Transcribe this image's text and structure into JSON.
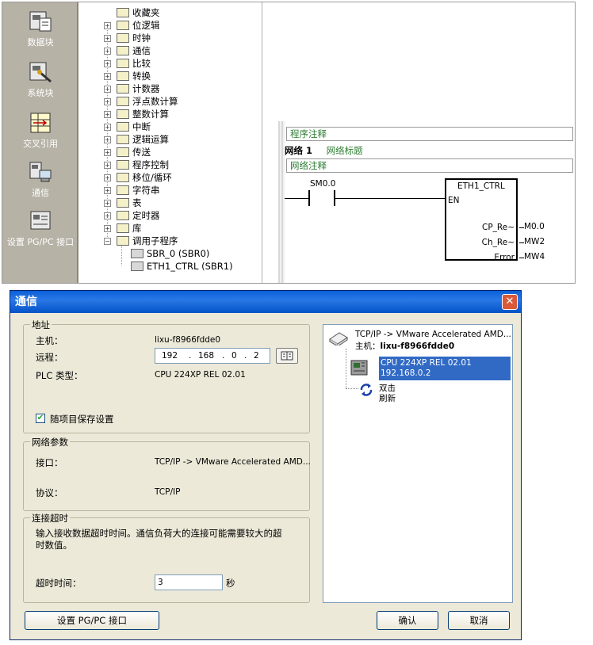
{
  "left_nav": {
    "items": [
      {
        "label": "数据块",
        "icon": "data-block-icon"
      },
      {
        "label": "系统块",
        "icon": "system-block-icon"
      },
      {
        "label": "交叉引用",
        "icon": "cross-reference-icon"
      },
      {
        "label": "通信",
        "icon": "communication-icon"
      },
      {
        "label": "设置 PG/PC 接口",
        "icon": "set-pgpc-interface-icon"
      }
    ]
  },
  "tree": {
    "items": [
      {
        "label": "收藏夹",
        "icon": "favorites-icon",
        "expandable": false
      },
      {
        "label": "位逻辑",
        "icon": "bit-logic-icon",
        "expandable": true
      },
      {
        "label": "时钟",
        "icon": "clock-icon",
        "expandable": true
      },
      {
        "label": "通信",
        "icon": "communication-icon",
        "expandable": true
      },
      {
        "label": "比较",
        "icon": "compare-icon",
        "expandable": true
      },
      {
        "label": "转换",
        "icon": "convert-icon",
        "expandable": true
      },
      {
        "label": "计数器",
        "icon": "counter-icon",
        "expandable": true
      },
      {
        "label": "浮点数计算",
        "icon": "float-math-icon",
        "expandable": true
      },
      {
        "label": "整数计算",
        "icon": "integer-math-icon",
        "expandable": true
      },
      {
        "label": "中断",
        "icon": "interrupt-icon",
        "expandable": true
      },
      {
        "label": "逻辑运算",
        "icon": "logic-op-icon",
        "expandable": true
      },
      {
        "label": "传送",
        "icon": "move-icon",
        "expandable": true
      },
      {
        "label": "程序控制",
        "icon": "program-control-icon",
        "expandable": true
      },
      {
        "label": "移位/循环",
        "icon": "shift-rotate-icon",
        "expandable": true
      },
      {
        "label": "字符串",
        "icon": "string-icon",
        "expandable": true
      },
      {
        "label": "表",
        "icon": "table-icon",
        "expandable": true
      },
      {
        "label": "定时器",
        "icon": "timer-icon",
        "expandable": true
      },
      {
        "label": "库",
        "icon": "library-icon",
        "expandable": true
      },
      {
        "label": "调用子程序",
        "icon": "call-subroutine-icon",
        "expandable": true,
        "expanded": true
      }
    ],
    "children": [
      {
        "label": "SBR_0 (SBR0)",
        "icon": "subroutine-icon"
      },
      {
        "label": "ETH1_CTRL (SBR1)",
        "icon": "locked-subroutine-icon"
      }
    ]
  },
  "editor": {
    "program_comment": "程序注释",
    "network_label": "网络 1",
    "network_title": "网络标题",
    "network_comment": "网络注释",
    "contact": "SM0.0",
    "block_name": "ETH1_CTRL",
    "en": "EN",
    "outputs": [
      {
        "pin": "CP_Re~",
        "operand": "M0.0"
      },
      {
        "pin": "Ch_Re~",
        "operand": "MW2"
      },
      {
        "pin": "Error",
        "operand": "MW4"
      }
    ]
  },
  "dialog": {
    "title": "通信",
    "address_group": "地址",
    "host_label": "主机：",
    "host_value": "lixu-f8966fdde0",
    "remote_label": "远程：",
    "ip_parts": [
      "192",
      "168",
      "0",
      "2"
    ],
    "ip_sep": ".",
    "plc_type_label": "PLC 类型：",
    "plc_type_value": "CPU 224XP REL 02.01",
    "save_with_project": "随项目保存设置",
    "checkmark": "✔",
    "network_group": "网络参数",
    "interface_label": "接口：",
    "interface_value": "TCP/IP -> VMware Accelerated AMD...",
    "protocol_label": "协议：",
    "protocol_value": "TCP/IP",
    "timeout_group": "连接超时",
    "timeout_desc_1": "输入接收数据超时时间。通信负荷大的连接可能需要较大的超",
    "timeout_desc_2": "时数值。",
    "timeout_label": "超时时间：",
    "timeout_value": "3",
    "timeout_unit": "秒",
    "set_pgpc_button": "设置 PG/PC 接口",
    "ok_button": "确认",
    "cancel_button": "取消",
    "close_glyph": "✕",
    "right_pane": {
      "network_line": "TCP/IP -> VMware Accelerated AMD...",
      "host_prefix": "主机：",
      "host_name": "lixu-f8966fdde0",
      "cpu_line1": "CPU 224XP REL 02.01",
      "cpu_line2": "192.168.0.2",
      "refresh_line1": "双击",
      "refresh_line2": "刷新"
    }
  }
}
